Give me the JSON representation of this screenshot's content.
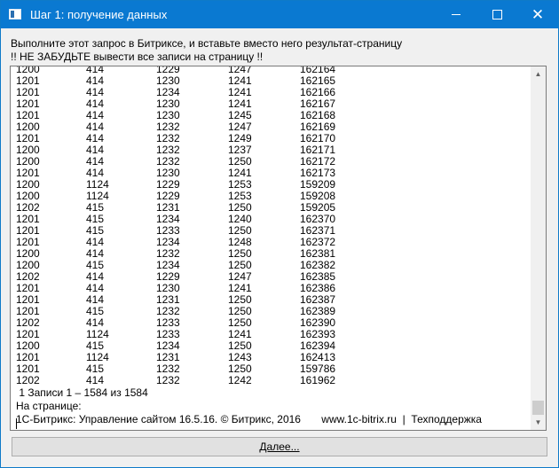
{
  "window": {
    "title": "Шаг 1: получение данных"
  },
  "icons": {
    "app": "app-window-icon",
    "minimize": "minimize-icon",
    "maximize": "maximize-icon",
    "close": "close-icon",
    "scroll_up": "chevron-up-icon",
    "scroll_down": "chevron-down-icon"
  },
  "instructions": {
    "line1": "Выполните этот запрос в Битриксе, и вставьте вместо него результат-страницу",
    "line2": "!! НЕ ЗАБУДЬТЕ вывести все записи на страницу !!"
  },
  "result_rows": [
    [
      "1200",
      "414",
      "1229",
      "1247",
      "162164"
    ],
    [
      "1201",
      "414",
      "1230",
      "1241",
      "162165"
    ],
    [
      "1201",
      "414",
      "1234",
      "1241",
      "162166"
    ],
    [
      "1201",
      "414",
      "1230",
      "1241",
      "162167"
    ],
    [
      "1201",
      "414",
      "1230",
      "1245",
      "162168"
    ],
    [
      "1200",
      "414",
      "1232",
      "1247",
      "162169"
    ],
    [
      "1201",
      "414",
      "1232",
      "1249",
      "162170"
    ],
    [
      "1200",
      "414",
      "1232",
      "1237",
      "162171"
    ],
    [
      "1200",
      "414",
      "1232",
      "1250",
      "162172"
    ],
    [
      "1201",
      "414",
      "1230",
      "1241",
      "162173"
    ],
    [
      "1200",
      "1124",
      "1229",
      "1253",
      "159209"
    ],
    [
      "1200",
      "1124",
      "1229",
      "1253",
      "159208"
    ],
    [
      "1202",
      "415",
      "1231",
      "1250",
      "159205"
    ],
    [
      "1201",
      "415",
      "1234",
      "1240",
      "162370"
    ],
    [
      "1201",
      "415",
      "1233",
      "1250",
      "162371"
    ],
    [
      "1201",
      "414",
      "1234",
      "1248",
      "162372"
    ],
    [
      "1200",
      "414",
      "1232",
      "1250",
      "162381"
    ],
    [
      "1200",
      "415",
      "1234",
      "1250",
      "162382"
    ],
    [
      "1202",
      "414",
      "1229",
      "1247",
      "162385"
    ],
    [
      "1201",
      "414",
      "1230",
      "1241",
      "162386"
    ],
    [
      "1201",
      "414",
      "1231",
      "1250",
      "162387"
    ],
    [
      "1201",
      "415",
      "1232",
      "1250",
      "162389"
    ],
    [
      "1202",
      "414",
      "1233",
      "1250",
      "162390"
    ],
    [
      "1201",
      "1124",
      "1233",
      "1241",
      "162393"
    ],
    [
      "1200",
      "415",
      "1234",
      "1250",
      "162394"
    ],
    [
      "1201",
      "1124",
      "1231",
      "1243",
      "162413"
    ],
    [
      "1201",
      "415",
      "1232",
      "1250",
      "159786"
    ],
    [
      "1202",
      "414",
      "1232",
      "1242",
      "161962"
    ]
  ],
  "footer_lines": {
    "records": " 1 Записи 1 – 1584 из 1584",
    "on_page": "На странице:",
    "copyright": "1С-Битрикс: Управление сайтом 16.5.16. © Битрикс, 2016       www.1c-bitrix.ru  |  Техподдержка"
  },
  "buttons": {
    "next": "Далее..."
  }
}
